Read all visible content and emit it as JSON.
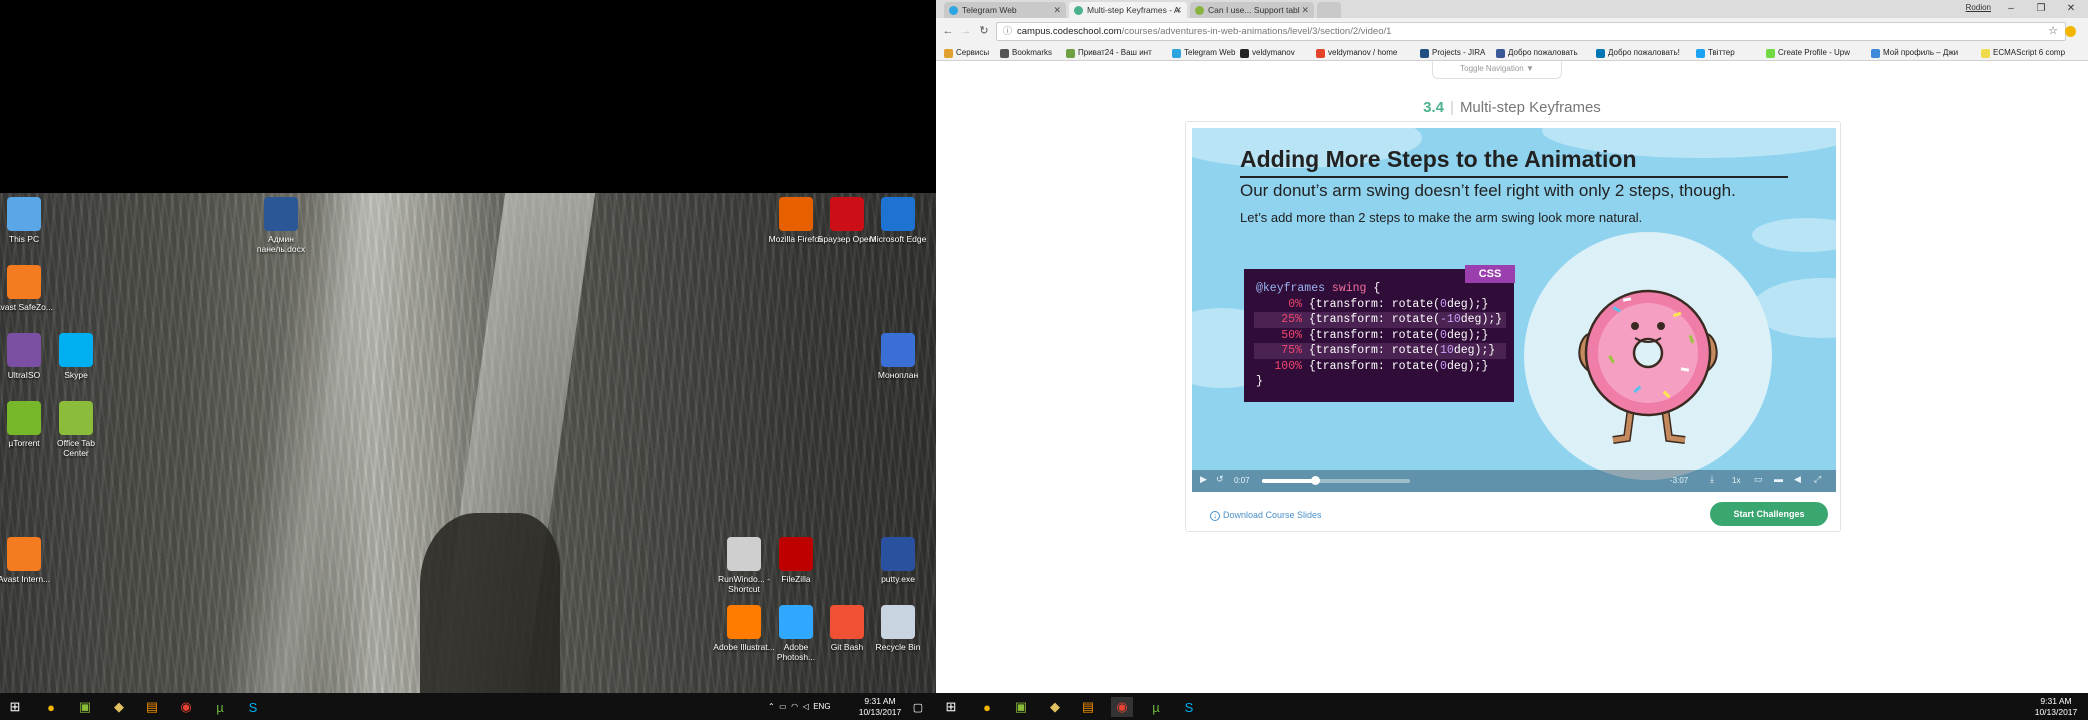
{
  "left_monitor": {
    "desktop_icons": [
      {
        "label": "This PC",
        "icon": "computer-icon",
        "color": "#5aa6e6"
      },
      {
        "label": "Админ панель.docx",
        "icon": "word-document-icon",
        "color": "#2b5797"
      },
      {
        "label": "Mozilla Firefox",
        "icon": "firefox-icon",
        "color": "#e66000"
      },
      {
        "label": "Браузер Opera",
        "icon": "opera-icon",
        "color": "#cc0f16"
      },
      {
        "label": "Microsoft Edge",
        "icon": "edge-icon",
        "color": "#1e73d2"
      },
      {
        "label": "Avast SafeZo...",
        "icon": "avast-safezone-icon",
        "color": "#f47b20"
      },
      {
        "label": "UltraISO",
        "icon": "ultraiso-icon",
        "color": "#7b4fa3"
      },
      {
        "label": "Skype",
        "icon": "skype-icon",
        "color": "#00aff0"
      },
      {
        "label": "Моноплан",
        "icon": "monoplan-icon",
        "color": "#3a6fd6"
      },
      {
        "label": "µTorrent",
        "icon": "utorrent-icon",
        "color": "#77b82a"
      },
      {
        "label": "Office Tab Center",
        "icon": "office-tab-icon",
        "color": "#8bbd3a"
      },
      {
        "label": "Avast Intern...",
        "icon": "avast-internet-icon",
        "color": "#f47b20"
      },
      {
        "label": "RunWindo... - Shortcut",
        "icon": "runwindow-icon",
        "color": "#cfcfcf"
      },
      {
        "label": "FileZilla",
        "icon": "filezilla-icon",
        "color": "#bf0000"
      },
      {
        "label": "putty.exe",
        "icon": "putty-icon",
        "color": "#2a50a0"
      },
      {
        "label": "Adobe Illustrat...",
        "icon": "illustrator-icon",
        "color": "#ff7c00"
      },
      {
        "label": "Adobe Photosh...",
        "icon": "photoshop-icon",
        "color": "#31a8ff"
      },
      {
        "label": "Git Bash",
        "icon": "git-bash-icon",
        "color": "#f05033"
      },
      {
        "label": "Recycle Bin",
        "icon": "recycle-bin-icon",
        "color": "#c8d4e0"
      }
    ],
    "taskbar": {
      "tray_lang": "ENG",
      "time": "9:31 AM",
      "date": "10/13/2017"
    }
  },
  "browser": {
    "tabs": [
      {
        "title": "Telegram Web",
        "color": "#2ca5e0"
      },
      {
        "title": "Multi-step Keyframes - A",
        "color": "#4bb28c"
      },
      {
        "title": "Can I use... Support tabl",
        "color": "#8bb33f"
      }
    ],
    "user": "Rodion",
    "url_host": "campus.codeschool.com",
    "url_path": "/courses/adventures-in-web-animations/level/3/section/2/video/1",
    "bookmarks": [
      {
        "label": "Сервисы",
        "color": "#e0a030"
      },
      {
        "label": "Bookmarks",
        "color": "#555555"
      },
      {
        "label": "Приват24 - Ваш инт",
        "color": "#6ea142"
      },
      {
        "label": "Telegram Web",
        "color": "#2ca5e0"
      },
      {
        "label": "veldymanov",
        "color": "#222222"
      },
      {
        "label": "veldymanov / home",
        "color": "#e24329"
      },
      {
        "label": "Projects - JIRA",
        "color": "#205081"
      },
      {
        "label": "Добро пожаловать",
        "color": "#3b5998"
      },
      {
        "label": "Добро пожаловать!",
        "color": "#0077b5"
      },
      {
        "label": "Твіттер",
        "color": "#1da1f2"
      },
      {
        "label": "Create Profile - Upw",
        "color": "#6fda44"
      },
      {
        "label": "Мой профиль – Джи",
        "color": "#3c8ad9"
      },
      {
        "label": "ECMAScript 6 comp",
        "color": "#f0db4f"
      }
    ]
  },
  "page": {
    "toggle_nav": "Toggle Navigation ▼",
    "lesson_number": "3.4",
    "lesson_title": "Multi-step Keyframes",
    "slide": {
      "title": "Adding More Steps to the Animation",
      "subtitle": "Our donut’s arm swing doesn’t feel right with only 2 steps, though.",
      "subtitle2": "Let’s add more than 2 steps to make the arm swing look more natural.",
      "badge": "CSS",
      "code_open": "@keyframes",
      "code_name": "swing",
      "code_brace": "{",
      "steps": [
        {
          "pct": "0%",
          "val": "0"
        },
        {
          "pct": "25%",
          "val": "-10"
        },
        {
          "pct": "50%",
          "val": "0"
        },
        {
          "pct": "75%",
          "val": "10"
        },
        {
          "pct": "100%",
          "val": "0"
        }
      ],
      "code_close": "}"
    },
    "video": {
      "elapsed": "0:07",
      "remaining": "-3:07",
      "speed": "1x",
      "progress": 0.36
    },
    "download_label": "Download Course Slides",
    "start_label": "Start Challenges"
  }
}
